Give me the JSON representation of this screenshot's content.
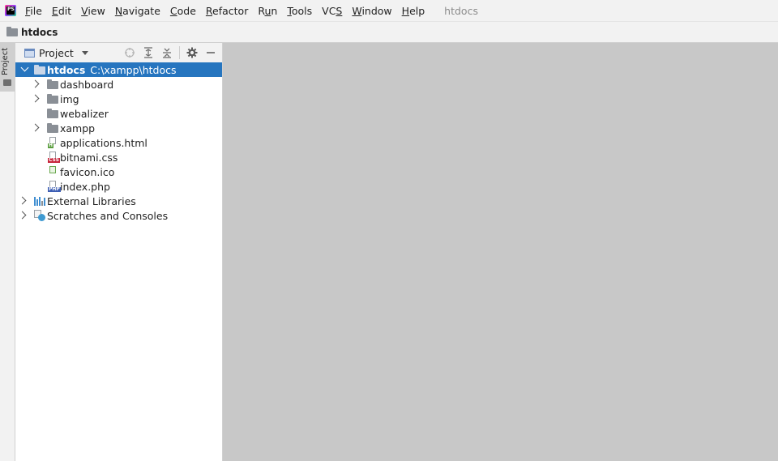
{
  "menubar": {
    "logo_text": "PS",
    "items": [
      {
        "mnemonic": "F",
        "rest": "ile"
      },
      {
        "mnemonic": "E",
        "rest": "dit"
      },
      {
        "mnemonic": "V",
        "rest": "iew"
      },
      {
        "mnemonic": "N",
        "rest": "avigate"
      },
      {
        "mnemonic": "C",
        "rest": "ode"
      },
      {
        "mnemonic": "R",
        "rest": "efactor"
      },
      {
        "pre": "R",
        "mnemonic": "u",
        "rest": "n"
      },
      {
        "mnemonic": "T",
        "rest": "ools"
      },
      {
        "pre": "VC",
        "mnemonic": "S",
        "rest": ""
      },
      {
        "mnemonic": "W",
        "rest": "indow"
      },
      {
        "mnemonic": "H",
        "rest": "elp"
      }
    ],
    "window_title": "htdocs"
  },
  "navbar": {
    "crumb": "htdocs"
  },
  "toolstrip": {
    "project_tab": "Project"
  },
  "panel": {
    "title": "Project",
    "tools": [
      "locate-icon",
      "expand-all-icon",
      "collapse-all-icon",
      "gear-icon",
      "minimize-icon"
    ]
  },
  "tree": {
    "root": {
      "label": "htdocs",
      "path": "C:\\xampp\\htdocs"
    },
    "items": [
      {
        "label": "dashboard",
        "kind": "folder",
        "expandable": true
      },
      {
        "label": "img",
        "kind": "folder",
        "expandable": true
      },
      {
        "label": "webalizer",
        "kind": "folder",
        "expandable": false
      },
      {
        "label": "xampp",
        "kind": "folder",
        "expandable": true
      },
      {
        "label": "applications.html",
        "kind": "html"
      },
      {
        "label": "bitnami.css",
        "kind": "css"
      },
      {
        "label": "favicon.ico",
        "kind": "ico"
      },
      {
        "label": "index.php",
        "kind": "php"
      }
    ],
    "external_libraries": "External Libraries",
    "scratches": "Scratches and Consoles"
  },
  "colors": {
    "selection": "#2675bf",
    "editor_bg": "#c8c8c8",
    "folder": "#8a8f96"
  }
}
